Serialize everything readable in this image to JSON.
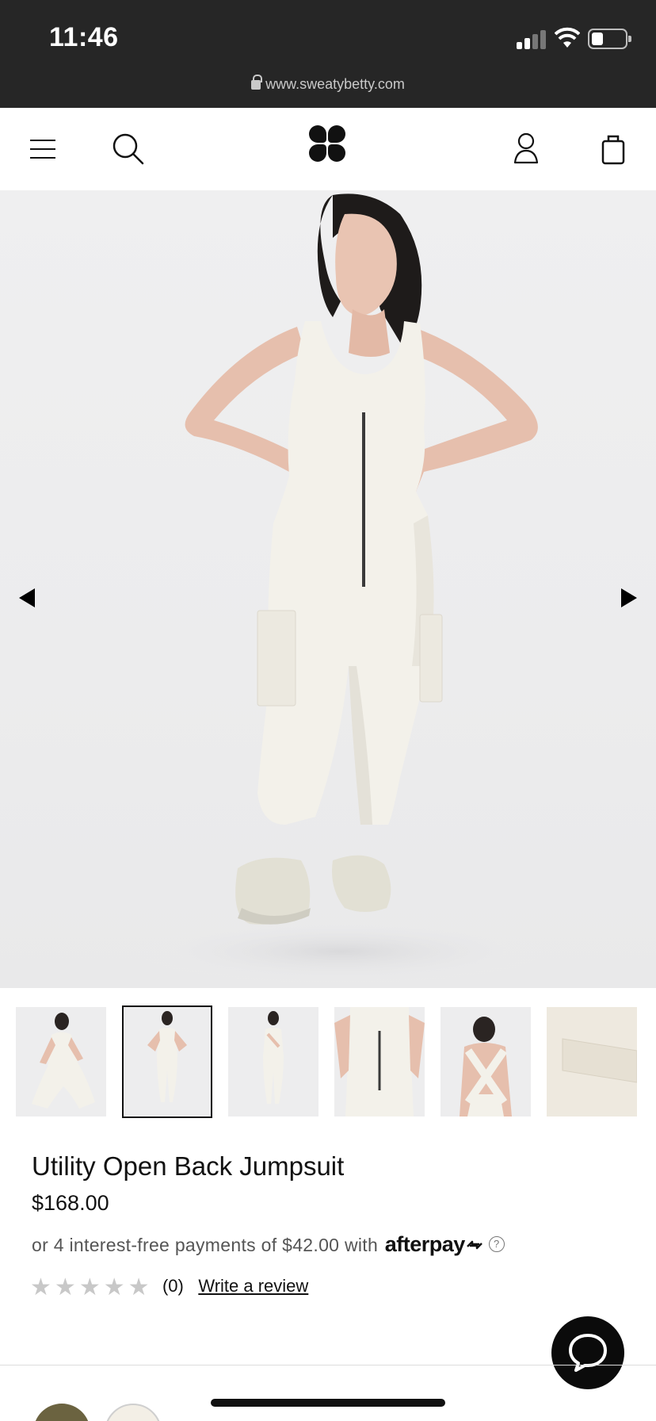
{
  "status_bar": {
    "time": "11:46",
    "url": "www.sweatybetty.com",
    "battery_level": 0.35
  },
  "header": {
    "menu_icon": "hamburger-menu-icon",
    "search_icon": "search-icon",
    "logo_icon": "sweaty-betty-logo",
    "account_icon": "account-icon",
    "bag_icon": "shopping-bag-icon"
  },
  "gallery": {
    "prev_icon": "triangle-left-icon",
    "next_icon": "triangle-right-icon",
    "thumbnail_count": 6,
    "selected_thumbnail": 2
  },
  "product": {
    "title": "Utility Open Back Jumpsuit",
    "price": "$168.00",
    "afterpay_text": "or 4 interest-free payments of $42.00 with",
    "afterpay_brand": "afterpay",
    "afterpay_info": "?",
    "rating_stars": 0,
    "rating_max": 5,
    "review_count": "(0)",
    "write_review": "Write a review"
  },
  "colors": {
    "status_bar_bg": "#262626",
    "accent": "#111111",
    "star_empty": "#c8c8c8"
  }
}
